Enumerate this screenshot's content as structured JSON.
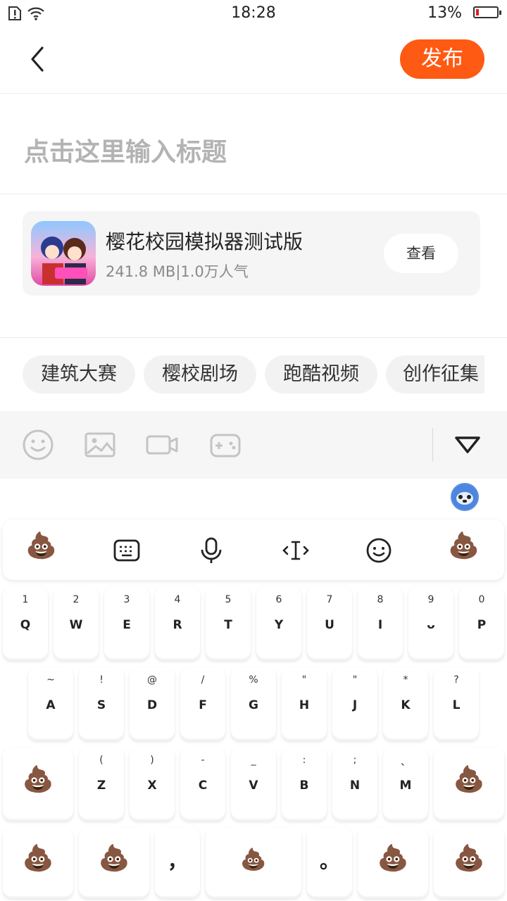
{
  "status_bar": {
    "time": "18:28",
    "battery_percent": "13%",
    "battery_level": 0.13
  },
  "header": {
    "publish_label": "发布"
  },
  "title_input": {
    "placeholder": "点击这里输入标题"
  },
  "game_card": {
    "name": "樱花校园模拟器测试版",
    "meta": "241.8 MB|1.0万人气",
    "view_label": "查看"
  },
  "tags": [
    "建筑大赛",
    "樱校剧场",
    "跑酷视频",
    "创作征集"
  ],
  "toolbar": {
    "icons": [
      "emoji-icon",
      "image-icon",
      "video-icon",
      "gamepad-icon"
    ],
    "collapse_icon": "triangle-down-icon"
  },
  "keyboard": {
    "candidate_bar": [
      "poop-emoji",
      "keyboard-icon",
      "microphone-icon",
      "cursor-icon",
      "smile-icon",
      "poop-emoji"
    ],
    "row1": [
      {
        "hint": "1",
        "main": "Q"
      },
      {
        "hint": "2",
        "main": "W"
      },
      {
        "hint": "3",
        "main": "E"
      },
      {
        "hint": "4",
        "main": "R"
      },
      {
        "hint": "5",
        "main": "T"
      },
      {
        "hint": "6",
        "main": "Y"
      },
      {
        "hint": "7",
        "main": "U"
      },
      {
        "hint": "8",
        "main": "I"
      },
      {
        "hint": "9",
        "main": "ᴗ"
      },
      {
        "hint": "0",
        "main": "P"
      }
    ],
    "row2": [
      {
        "hint": "~",
        "main": "A"
      },
      {
        "hint": "!",
        "main": "S"
      },
      {
        "hint": "@",
        "main": "D"
      },
      {
        "hint": "/",
        "main": "F"
      },
      {
        "hint": "%",
        "main": "G"
      },
      {
        "hint": "\"",
        "main": "H"
      },
      {
        "hint": "\"",
        "main": "J"
      },
      {
        "hint": "*",
        "main": "K"
      },
      {
        "hint": "?",
        "main": "L"
      }
    ],
    "row3": [
      {
        "hint": "(",
        "main": "Z"
      },
      {
        "hint": ")",
        "main": "X"
      },
      {
        "hint": "-",
        "main": "C"
      },
      {
        "hint": "_",
        "main": "V"
      },
      {
        "hint": ":",
        "main": "B"
      },
      {
        "hint": ";",
        "main": "N"
      },
      {
        "hint": "、",
        "main": "M"
      }
    ],
    "row4": {
      "comma": "，",
      "period": "。"
    },
    "emoji": "💩"
  }
}
